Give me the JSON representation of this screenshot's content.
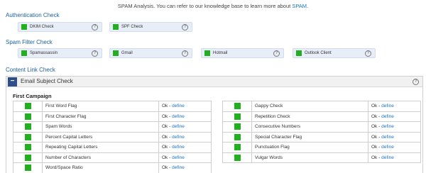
{
  "header": {
    "info_text": "SPAM Analysis. You can refer to our knowledge base to learn more about",
    "info_link": "SPAM",
    "info_end": "."
  },
  "auth": {
    "title": "Authentication Check",
    "items": [
      {
        "label": "DKIM Check",
        "status_color": "#22b020"
      },
      {
        "label": "SPF Check",
        "status_color": "#22b020"
      }
    ]
  },
  "spam_filter": {
    "title": "Spam Filter Check",
    "items": [
      {
        "label": "Spamassassin",
        "status_color": "#22b020"
      },
      {
        "label": "Gmail",
        "status_color": "#22b020"
      },
      {
        "label": "Hotmail",
        "status_color": "#22b020"
      },
      {
        "label": "Outlook Client",
        "status_color": "#22b020"
      }
    ]
  },
  "content_link": {
    "title": "Content Link Check"
  },
  "email_subject": {
    "title": "Email Subject Check",
    "campaign": "First Campaign",
    "left_rows": [
      {
        "name": "First Word Flag",
        "status": "Ok",
        "link": "define"
      },
      {
        "name": "First Character Flag",
        "status": "Ok",
        "link": "define"
      },
      {
        "name": "Spam Words",
        "status": "Ok",
        "link": "define"
      },
      {
        "name": "Percent Capital Letters",
        "status": "Ok",
        "link": "define"
      },
      {
        "name": "Repeating Capital Letters",
        "status": "Ok",
        "link": "define"
      },
      {
        "name": "Number of Characters",
        "status": "Ok",
        "link": "define"
      },
      {
        "name": "Word/Space Ratio",
        "status": "Ok",
        "link": "define"
      }
    ],
    "right_rows": [
      {
        "name": "Gappy Check",
        "status": "Ok",
        "link": "define"
      },
      {
        "name": "Repetition Check",
        "status": "Ok",
        "link": "define"
      },
      {
        "name": "Consecutive Numbers",
        "status": "Ok",
        "link": "define"
      },
      {
        "name": "Special Character Flag",
        "status": "Ok",
        "link": "define"
      },
      {
        "name": "Punctuation Flag",
        "status": "Ok",
        "link": "define"
      },
      {
        "name": "Vulgar Words",
        "status": "Ok",
        "link": "define"
      }
    ]
  },
  "colors": {
    "pass": "#22b020",
    "accent": "#1c5f9c",
    "link": "#1a73c9"
  }
}
